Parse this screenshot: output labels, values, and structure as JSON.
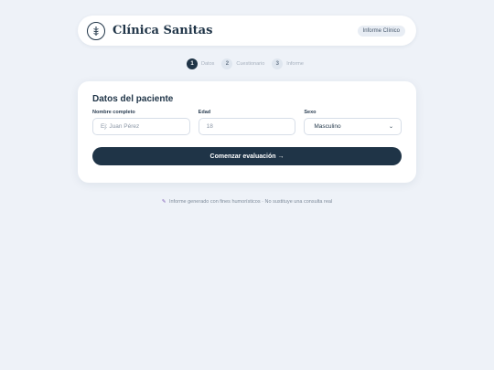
{
  "header": {
    "brand": "Clínica Sanitas",
    "badge": "Informe Clínico",
    "logo_icon": "caduceus-icon"
  },
  "steps": [
    {
      "number": "1",
      "label": "Datos",
      "active": true
    },
    {
      "number": "2",
      "label": "Cuestionario",
      "active": false
    },
    {
      "number": "3",
      "label": "Informe",
      "active": false
    }
  ],
  "form": {
    "title": "Datos del paciente",
    "name": {
      "label": "Nombre completo",
      "placeholder": "Ej: Juan Pérez",
      "value": ""
    },
    "age": {
      "label": "Edad",
      "placeholder": "18",
      "value": ""
    },
    "sex": {
      "label": "Sexo",
      "value": "Masculino"
    },
    "submit_label": "Comenzar evaluación →"
  },
  "footer": {
    "icon": "✎",
    "text": "Informe generado con fines humorísticos · No sustituye una consulta real"
  },
  "colors": {
    "primary": "#1f3447",
    "background": "#eef2f8",
    "card": "#ffffff"
  }
}
